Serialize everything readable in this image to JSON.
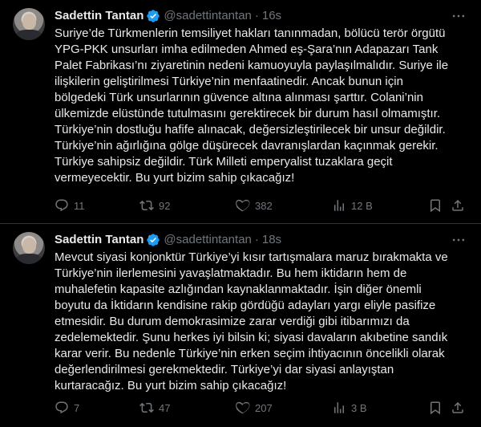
{
  "tweets": [
    {
      "author_name": "Sadettin Tantan",
      "handle": "@sadettintantan",
      "separator": "·",
      "time": "16s",
      "text": "Suriye’de Türkmenlerin temsiliyet hakları tanınmadan, bölücü terör örgütü\nYPG-PKK unsurları imha edilmeden Ahmed eş-Şara’nın Adapazarı Tank\nPalet Fabrikası’nı ziyaretinin nedeni kamuoyuyla paylaşılmalıdır. Suriye ile\nilişkilerin geliştirilmesi Türkiye’nin menfaatinedir. Ancak bunun için\nbölgedeki Türk unsurlarının güvence altına alınması şarttır. Colani’nin\nülkemizde elüstünde tutulmasını gerektirecek bir durum hasıl olmamıştır.\nTürkiye’nin dostluğu hafife alınacak, değersizleştirilecek bir unsur değildir.\nTürkiye’nin ağırlığına gölge düşürecek davranışlardan kaçınmak gerekir.\nTürkiye sahipsiz değildir. Türk Milleti emperyalist tuzaklara geçit\nvermeyecektir. Bu yurt bizim sahip çıkacağız!",
      "replies": "11",
      "retweets": "92",
      "likes": "382",
      "views": "12 B"
    },
    {
      "author_name": "Sadettin Tantan",
      "handle": "@sadettintantan",
      "separator": "·",
      "time": "18s",
      "text": "Mevcut siyasi konjonktür Türkiye’yi kısır tartışmalara maruz bırakmakta ve\nTürkiye’nin ilerlemesini yavaşlatmaktadır. Bu hem iktidarın hem de\nmuhalefetin kapasite azlığından kaynaklanmaktadır. İşin diğer önemli\nboyutu da İktidarın kendisine rakip gördüğü adayları yargı eliyle pasifize\netmesidir. Bu durum demokrasimize zarar verdiği gibi itibarımızı da\nzedelemektedir. Şunu herkes iyi bilsin ki; siyasi davaların akıbetine sandık\nkarar verir. Bu nedenle Türkiye’nin erken seçim ihtiyacının öncelikli olarak\ndeğerlendirilmesi gerekmektedir. Türkiye’yi dar siyasi anlayıştan\nkurtaracağız. Bu yurt bizim sahip çıkacağız!",
      "replies": "7",
      "retweets": "47",
      "likes": "207",
      "views": "3 B"
    }
  ],
  "icons": {
    "verified": "verified-badge-icon",
    "more": "more-icon",
    "reply": "reply-icon",
    "retweet": "retweet-icon",
    "like": "like-icon",
    "views": "views-icon",
    "bookmark": "bookmark-icon",
    "share": "share-icon"
  },
  "colors": {
    "background": "#000000",
    "text": "#e7e9ea",
    "muted": "#71767b",
    "verified": "#1d9bf0",
    "divider": "#2f3336"
  }
}
